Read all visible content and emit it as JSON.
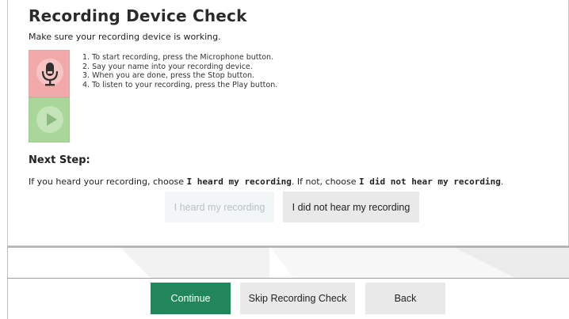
{
  "page": {
    "title": "Recording Device Check",
    "subtitle": "Make sure your recording device is working."
  },
  "controls": {
    "mic_icon": "microphone-icon",
    "play_icon": "play-icon"
  },
  "instructions": [
    "1. To start recording, press the Microphone button.",
    "2. Say your name into your recording device.",
    "3. When you are done, press the Stop button.",
    "4. To listen to your recording, press the Play button."
  ],
  "next_step": {
    "heading": "Next Step:",
    "text_1": "If you heard your recording, choose ",
    "emph_1": "I heard my recording",
    "text_2": ". If not, choose ",
    "emph_2": "I did not hear my recording",
    "text_3": "."
  },
  "response_buttons": {
    "heard": "I heard my recording",
    "not_heard": "I did not hear my recording"
  },
  "footer": {
    "continue": "Continue",
    "skip": "Skip Recording Check",
    "back": "Back"
  },
  "colors": {
    "continue_bg": "#21875a",
    "record_bg": "#f2a9a9",
    "play_bg": "#a9d79a"
  }
}
